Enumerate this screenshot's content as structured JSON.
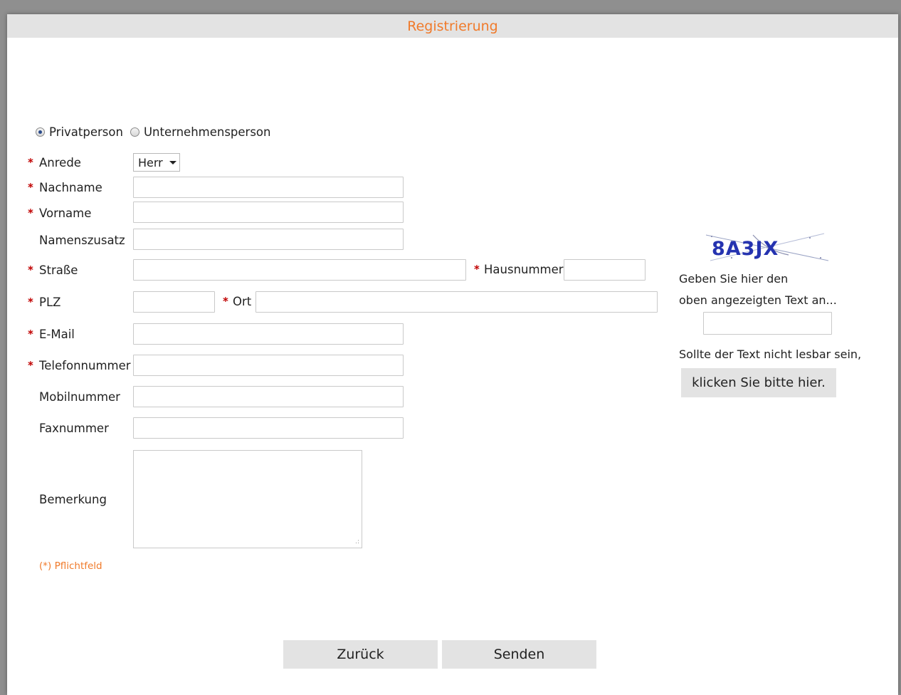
{
  "colors": {
    "accent": "#f07a2a",
    "required_star": "#c00000",
    "button_bg": "#e3e3e3",
    "titlebar_bg": "#e3e3e3"
  },
  "window": {
    "title": "Registrierung"
  },
  "person_type": {
    "options": [
      {
        "label": "Privatperson",
        "selected": true
      },
      {
        "label": "Unternehmensperson",
        "selected": false
      }
    ]
  },
  "fields": {
    "anrede": {
      "label": "Anrede",
      "required": true,
      "value": "Herr"
    },
    "nachname": {
      "label": "Nachname",
      "required": true,
      "value": ""
    },
    "vorname": {
      "label": "Vorname",
      "required": true,
      "value": ""
    },
    "namenszusatz": {
      "label": "Namenszusatz",
      "required": false,
      "value": ""
    },
    "strasse": {
      "label": "Straße",
      "required": true,
      "value": ""
    },
    "hausnummer": {
      "label": "Hausnummer",
      "required": true,
      "value": ""
    },
    "plz": {
      "label": "PLZ",
      "required": true,
      "value": ""
    },
    "ort": {
      "label": "Ort",
      "required": true,
      "value": ""
    },
    "email": {
      "label": "E-Mail",
      "required": true,
      "value": ""
    },
    "telefonnummer": {
      "label": "Telefonnummer",
      "required": true,
      "value": ""
    },
    "mobilnummer": {
      "label": "Mobilnummer",
      "required": false,
      "value": ""
    },
    "faxnummer": {
      "label": "Faxnummer",
      "required": false,
      "value": ""
    },
    "bemerkung": {
      "label": "Bemerkung",
      "required": false,
      "value": ""
    }
  },
  "required_marker": "*",
  "required_hint": "(*) Pflichtfeld",
  "captcha": {
    "image_text": "8A3JX",
    "instruction_line1": "Geben Sie hier den",
    "instruction_line2": "oben angezeigten Text an...",
    "value": "",
    "unreadable_text": "Sollte der Text nicht lesbar sein,",
    "refresh_button": "klicken Sie bitte hier."
  },
  "footer": {
    "back_button": "Zurück",
    "send_button": "Senden"
  }
}
